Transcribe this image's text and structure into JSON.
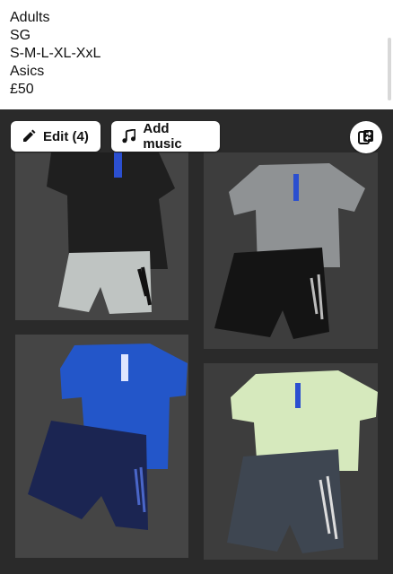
{
  "caption": {
    "lines": [
      "Adults",
      "SG",
      "S-M-L-XL-XxL",
      "Asics",
      "£50"
    ]
  },
  "toolbar": {
    "edit_label": "Edit (4)",
    "music_label": "Add music",
    "edit_icon": "pencil-icon",
    "music_icon": "music-note-icon",
    "swap_icon": "shuffle-cards-icon"
  },
  "photos": [
    {
      "name": "black-tshirt-grey-shorts",
      "shirt_color": "#1f1f1f",
      "shorts_color": "#bfc4c2"
    },
    {
      "name": "grey-tshirt-black-shorts",
      "shirt_color": "#8f9294",
      "shorts_color": "#141414"
    },
    {
      "name": "blue-tshirt-navy-shorts",
      "shirt_color": "#2356c9",
      "shorts_color": "#1b2552"
    },
    {
      "name": "mint-tshirt-charcoal-shorts",
      "shirt_color": "#d6e9bd",
      "shorts_color": "#3e4651"
    }
  ]
}
